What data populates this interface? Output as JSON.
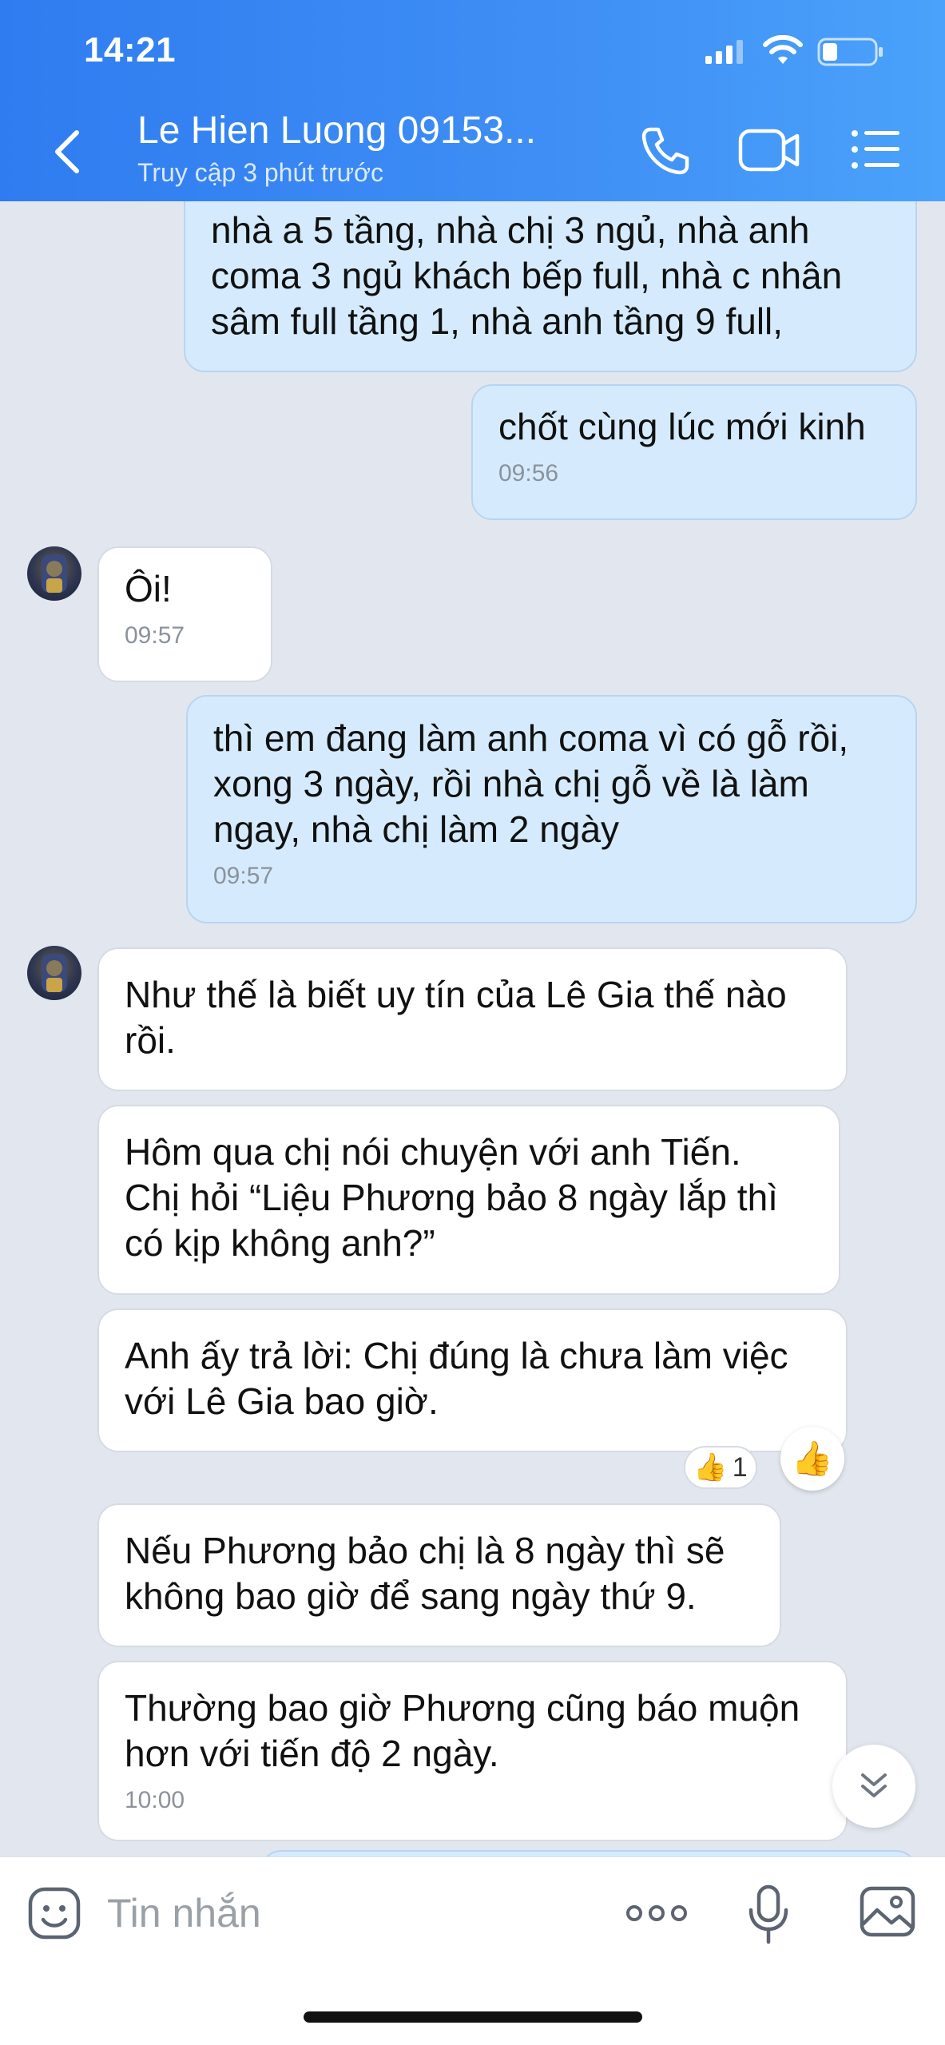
{
  "status_bar": {
    "time": "14:21"
  },
  "header": {
    "contact_name": "Le Hien Luong 09153...",
    "contact_status": "Truy cập 3 phút trước"
  },
  "messages": [
    {
      "direction": "out",
      "lines": [
        "nhà a 5 tầng, nhà chị 3 ngủ, nhà anh",
        "coma 3 ngủ khách bếp full, nhà c nhân",
        "sâm full tầng 1, nhà anh tầng 9 full,"
      ],
      "time": ""
    },
    {
      "direction": "out",
      "lines": [
        "chốt cùng lúc mới kinh"
      ],
      "time": "09:56"
    },
    {
      "direction": "in",
      "lines": [
        "Ôi!"
      ],
      "time": "09:57"
    },
    {
      "direction": "out",
      "lines": [
        "thì em đang làm anh coma vì có gỗ rồi,",
        "xong 3 ngày, rồi nhà chị gỗ về là làm",
        "ngay, nhà chị làm 2 ngày"
      ],
      "time": "09:57"
    },
    {
      "direction": "in",
      "lines": [
        "Như thế là biết uy tín của Lê Gia thế nào",
        "rồi."
      ],
      "time": ""
    },
    {
      "direction": "in",
      "lines": [
        "Hôm qua chị nói chuyện với anh Tiến.",
        "Chị hỏi “Liệu Phương bảo 8 ngày lắp thì",
        "có kịp không anh?”"
      ],
      "time": ""
    },
    {
      "direction": "in",
      "lines": [
        "Anh ấy trả lời: Chị đúng là chưa làm việc",
        "với Lê Gia bao giờ."
      ],
      "time": ""
    },
    {
      "direction": "in",
      "lines": [
        "Nếu Phương bảo chị là 8 ngày thì sẽ",
        "không bao giờ để sang ngày thứ 9."
      ],
      "time": ""
    },
    {
      "direction": "in",
      "lines": [
        "Thường bao giờ Phương cũng báo muộn",
        "hơn với tiến độ 2 ngày."
      ],
      "time": "10:00"
    }
  ],
  "reaction": {
    "emoji": "👍",
    "count": "1"
  },
  "input": {
    "placeholder": "Tin nhắn"
  },
  "colors": {
    "header_blue": "#3a88f3",
    "outgoing_bubble": "#d5ebfd",
    "incoming_bubble": "#ffffff",
    "chat_background": "#e2e7ef"
  },
  "icons": [
    "back-icon",
    "phone-icon",
    "video-camera-icon",
    "list-menu-icon",
    "sticker-icon",
    "more-dots-icon",
    "microphone-icon",
    "image-icon",
    "chevron-double-down-icon",
    "thumbs-up-icon"
  ]
}
